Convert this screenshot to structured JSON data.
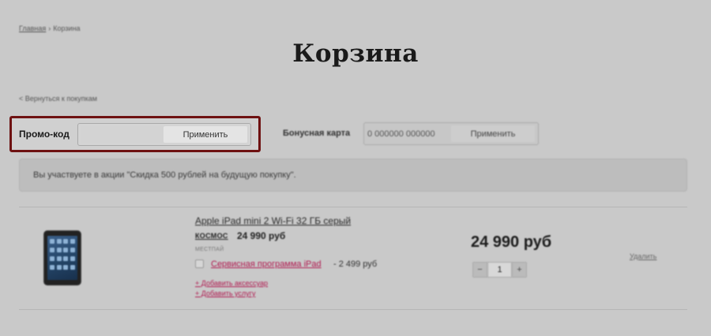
{
  "breadcrumb": {
    "home": "Главная",
    "separator": "›",
    "current": "Корзина"
  },
  "page_title": "Корзина",
  "back_link": "< Вернуться к покупкам",
  "promo": {
    "label": "Промо-код",
    "value": "",
    "apply_label": "Применить"
  },
  "bonus": {
    "label": "Бонусная карта",
    "value": "0 000000 000000",
    "apply_label": "Применить"
  },
  "notice": "Вы участвуете в акции \"Скидка 500 рублей на будущую покупку\".",
  "product": {
    "title": "Apple iPad mini 2 Wi-Fi 32 ГБ серый",
    "brand": "КОСМОС",
    "unit_price": "24 990 руб",
    "store_note": "МЕСТПАЙ",
    "service_link": "Сервисная программа iPad",
    "service_price": "- 2 499 руб",
    "add_accessory": "+ Добавить аксессуар",
    "add_service": "+ Добавить услугу",
    "total_price": "24 990 руб",
    "quantity": "1",
    "qty_minus": "−",
    "qty_plus": "+",
    "remove_label": "Удалить"
  },
  "colors": {
    "highlight_border": "#6e1111",
    "link_pink": "#b0194f",
    "overlay_gray": "#c9c9c9"
  }
}
